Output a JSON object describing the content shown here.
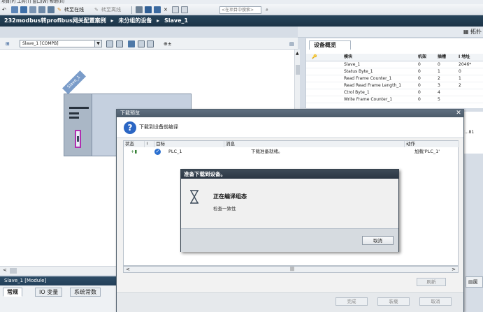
{
  "menubar": {
    "text": "项目(P)   工具(T)   窗口(W)   帮助(H)"
  },
  "toolbar": {
    "go_online": "转至在线",
    "go_offline": "转至离线",
    "search_placeholder": "<在项目中搜索>"
  },
  "breadcrumb": {
    "project": "232modbus转profibus网关配置案例",
    "sep1": "▸",
    "group": "未分组的设备",
    "sep2": "▸",
    "device": "Slave_1"
  },
  "topology": {
    "label": "拓扑"
  },
  "editor": {
    "device_selector": "Slave_1 [COMPB]",
    "module_label": "Slave_1"
  },
  "overview": {
    "tab": "设备概览",
    "headers": [
      "模块",
      "机架",
      "插槽",
      "I 地址"
    ],
    "rows": [
      [
        "Slave_1",
        "0",
        "0",
        "2046*"
      ],
      [
        "Status Byte_1",
        "0",
        "1",
        "0"
      ],
      [
        "Read Frame Counter_1",
        "0",
        "2",
        "1"
      ],
      [
        "Read Read Frame Length_1",
        "0",
        "3",
        "2"
      ],
      [
        "Ctrol Byte_1",
        "0",
        "4",
        ""
      ],
      [
        "Write Frame Counter_1",
        "0",
        "5",
        ""
      ]
    ],
    "side_value": "2...81"
  },
  "inspector": {
    "title": "Slave_1 [Module]",
    "tabs": [
      "常规",
      "IO 变量",
      "系统常数"
    ],
    "property_tab": "属"
  },
  "dialog": {
    "title": "下载预览",
    "heading": "下载到设备前编译",
    "columns": [
      "状态",
      "!",
      "目标",
      "消息",
      "动作"
    ],
    "row": {
      "target": "PLC_1",
      "message": "下载准备就绪。",
      "action": "加载'PLC_1'"
    },
    "refresh": "刷新",
    "buttons": {
      "finish": "完成",
      "load": "装载",
      "cancel": "取消"
    }
  },
  "progress": {
    "title": "准备下载到设备。",
    "status": "正在编译组态",
    "detail": "检查一致性",
    "cancel": "取消"
  }
}
